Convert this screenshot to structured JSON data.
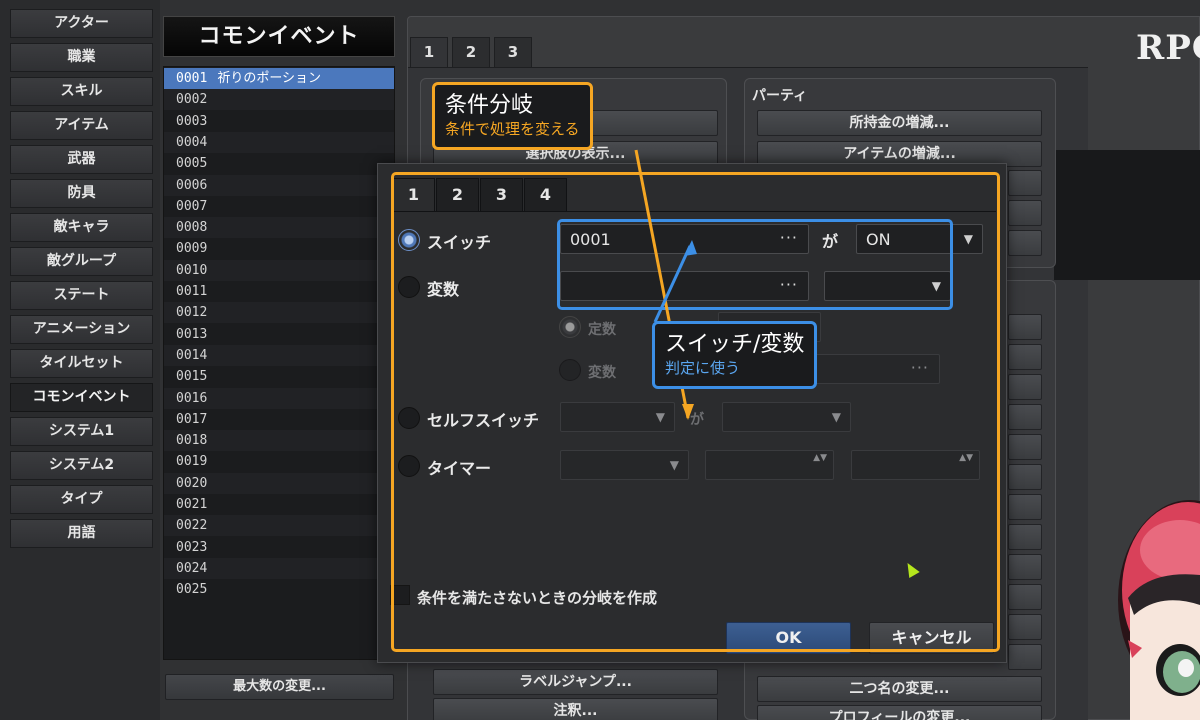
{
  "sidebar": {
    "tabs": [
      {
        "label": "アクター"
      },
      {
        "label": "職業"
      },
      {
        "label": "スキル"
      },
      {
        "label": "アイテム"
      },
      {
        "label": "武器"
      },
      {
        "label": "防具"
      },
      {
        "label": "敵キャラ"
      },
      {
        "label": "敵グループ"
      },
      {
        "label": "ステート"
      },
      {
        "label": "アニメーション"
      },
      {
        "label": "タイルセット"
      },
      {
        "label": "コモンイベント"
      },
      {
        "label": "システム1"
      },
      {
        "label": "システム2"
      },
      {
        "label": "タイプ"
      },
      {
        "label": "用語"
      }
    ],
    "active_index": 11
  },
  "common_events": {
    "title": "コモンイベント",
    "rows": [
      {
        "id": "0001",
        "name": "祈りのポーション"
      },
      {
        "id": "0002",
        "name": ""
      },
      {
        "id": "0003",
        "name": ""
      },
      {
        "id": "0004",
        "name": ""
      },
      {
        "id": "0005",
        "name": ""
      },
      {
        "id": "0006",
        "name": ""
      },
      {
        "id": "0007",
        "name": ""
      },
      {
        "id": "0008",
        "name": ""
      },
      {
        "id": "0009",
        "name": ""
      },
      {
        "id": "0010",
        "name": ""
      },
      {
        "id": "0011",
        "name": ""
      },
      {
        "id": "0012",
        "name": ""
      },
      {
        "id": "0013",
        "name": ""
      },
      {
        "id": "0014",
        "name": ""
      },
      {
        "id": "0015",
        "name": ""
      },
      {
        "id": "0016",
        "name": ""
      },
      {
        "id": "0017",
        "name": ""
      },
      {
        "id": "0018",
        "name": ""
      },
      {
        "id": "0019",
        "name": ""
      },
      {
        "id": "0020",
        "name": ""
      },
      {
        "id": "0021",
        "name": ""
      },
      {
        "id": "0022",
        "name": ""
      },
      {
        "id": "0023",
        "name": ""
      },
      {
        "id": "0024",
        "name": ""
      },
      {
        "id": "0025",
        "name": ""
      }
    ],
    "selected_index": 0,
    "max_button_label": "最大数の変更..."
  },
  "command_window": {
    "logo": "RPG",
    "tabs": [
      "1",
      "2",
      "3"
    ],
    "party_group_title": "パーティ",
    "left_buttons_top": [
      "",
      "選択肢の表示..."
    ],
    "party_buttons": [
      "所持金の増減...",
      "アイテムの増減..."
    ],
    "left_buttons_bottom": [
      "ラベルジャンプ...",
      "注釈..."
    ],
    "right_buttons_bottom": [
      "二つ名の変更...",
      "プロフィールの変更..."
    ]
  },
  "dialog": {
    "tabs": [
      "1",
      "2",
      "3",
      "4"
    ],
    "switch_label": "スイッチ",
    "switch_value": "0001",
    "switch_connector": "が",
    "switch_state": "ON",
    "variable_label": "変数",
    "constant_label": "定数",
    "variable_sub_label": "変数",
    "self_switch_label": "セルフスイッチ",
    "self_switch_connector": "が",
    "timer_label": "タイマー",
    "else_branch_label": "条件を満たさないときの分岐を作成",
    "ok_label": "OK",
    "cancel_label": "キャンセル",
    "ellipsis": "···",
    "dropdown_arrow": "▼",
    "spinner_arrows": "▲▼"
  },
  "annotations": {
    "branch": {
      "title": "条件分岐",
      "subtitle": "条件で処理を変える",
      "color": "#f5a623"
    },
    "switch_var": {
      "title": "スイッチ/変数",
      "subtitle": "判定に使う",
      "color": "#3c8fe6"
    }
  },
  "colors": {
    "selection": "#4b78bd",
    "ok_button": "#2c4a78",
    "cursor": "#b5e61d"
  }
}
